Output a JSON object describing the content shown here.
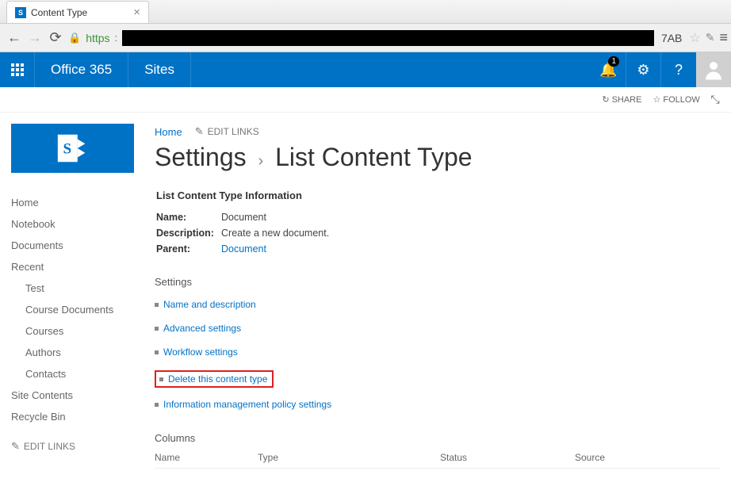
{
  "browser": {
    "tab_title": "Content Type",
    "url_proto": "https",
    "url_tail": "7AB"
  },
  "suite_bar": {
    "brand": "Office 365",
    "app": "Sites",
    "notifications_badge": "1"
  },
  "action_bar": {
    "share": "SHARE",
    "follow": "FOLLOW"
  },
  "breadcrumb": {
    "home": "Home",
    "edit_links": "EDIT LINKS"
  },
  "heading": {
    "settings": "Settings",
    "page_title": "List Content Type"
  },
  "nav": {
    "items": [
      {
        "label": "Home"
      },
      {
        "label": "Notebook"
      },
      {
        "label": "Documents"
      },
      {
        "label": "Recent"
      },
      {
        "label": "Site Contents"
      },
      {
        "label": "Recycle Bin"
      }
    ],
    "recent_children": [
      {
        "label": "Test"
      },
      {
        "label": "Course Documents"
      },
      {
        "label": "Courses"
      },
      {
        "label": "Authors"
      },
      {
        "label": "Contacts"
      }
    ],
    "edit_links": "EDIT LINKS"
  },
  "info": {
    "heading": "List Content Type Information",
    "name_label": "Name:",
    "name_val": "Document",
    "desc_label": "Description:",
    "desc_val": "Create a new document.",
    "parent_label": "Parent:",
    "parent_val": "Document"
  },
  "settings": {
    "heading": "Settings",
    "links": [
      {
        "label": "Name and description"
      },
      {
        "label": "Advanced settings"
      },
      {
        "label": "Workflow settings"
      },
      {
        "label": "Delete this content type",
        "highlight": true
      },
      {
        "label": "Information management policy settings"
      }
    ]
  },
  "columns": {
    "heading": "Columns",
    "headers": {
      "name": "Name",
      "type": "Type",
      "status": "Status",
      "source": "Source"
    }
  }
}
